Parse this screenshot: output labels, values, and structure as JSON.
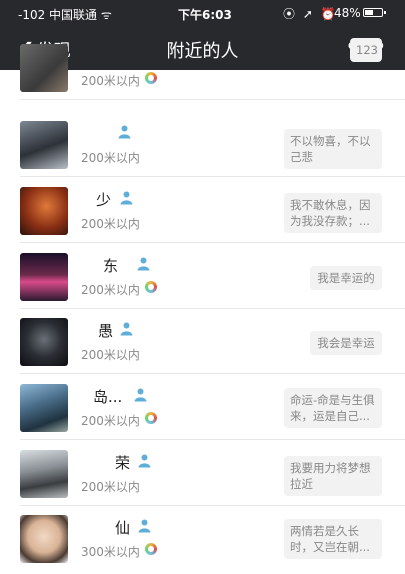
{
  "status_bar": {
    "carrier": "-102 中国联通",
    "wifi_icon": "wifi-icon",
    "time": "下午6:03",
    "icons": "⦿ ➚ ⏰",
    "battery_text": "48%",
    "battery_level": 0.48
  },
  "navbar": {
    "back_label": "发现",
    "title": "附近的人",
    "more_label": "•••"
  },
  "rows": [
    {
      "name": "",
      "distance": "200米以内",
      "signature": "123",
      "gender": false,
      "ring": true
    },
    {
      "name": "",
      "distance": "200米以内",
      "signature": "不以物喜，不以己悲",
      "gender": true,
      "ring": false
    },
    {
      "name": "少",
      "distance": "200米以内",
      "signature": "我不敢休息，因为我没存款；...",
      "gender": true,
      "ring": false
    },
    {
      "name": "东",
      "distance": "200米以内",
      "signature": "我是幸运的",
      "gender": true,
      "ring": true
    },
    {
      "name": "愚",
      "distance": "200米以内",
      "signature": "我会是幸运",
      "gender": true,
      "ring": false
    },
    {
      "name": "岛...",
      "distance": "200米以内",
      "signature": "命运-命是与生俱来，运是自己...",
      "gender": true,
      "ring": true
    },
    {
      "name": "荣",
      "distance": "200米以内",
      "signature": "我要用力将梦想拉近",
      "gender": true,
      "ring": false
    },
    {
      "name": "仙",
      "distance": "300米以内",
      "signature": "两情若是久长时，又岂在朝...",
      "gender": true,
      "ring": true
    }
  ],
  "colors": {
    "bar_bg": "#28292d",
    "gender_blue": "#5eaed8"
  }
}
